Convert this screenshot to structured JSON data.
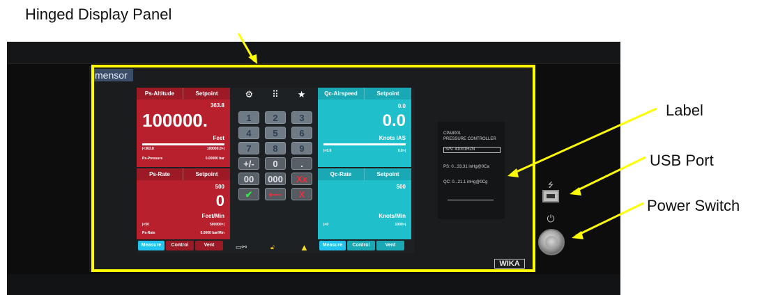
{
  "callouts": {
    "hinged_display_panel": "Hinged Display Panel",
    "label": "Label",
    "usb_port": "USB Port",
    "power_switch": "Power Switch"
  },
  "colors": {
    "callout_line": "#ffff00",
    "red_panel": "#b8202e",
    "cyan_panel": "#1fc0cc",
    "active_tab": "#21c3ef"
  },
  "device": {
    "brand": "mensor",
    "maker_badge": "WIKA"
  },
  "screen": {
    "left_top": {
      "header_a": "Ps-Altitude",
      "header_b": "Setpoint",
      "setpoint": "363.8",
      "reading": "100000.",
      "unit": "Feet",
      "range_min": "|<363.8",
      "range_max": "100000.0>|",
      "footer_label": "Ps-Pressure",
      "footer_value": "0.00000 bar",
      "bar_fill": 0.95
    },
    "left_bottom": {
      "header_a": "Ps-Rate",
      "header_b": "Setpoint",
      "setpoint": "500",
      "reading": "0",
      "unit": "Feet/Min",
      "range_min": "|<50",
      "range_max": "500000>|",
      "footer_label": "Ps-Rate",
      "footer_value": "0.0000 bar/Min"
    },
    "left_tabs": [
      "Measure",
      "Control",
      "Vent"
    ],
    "right_top": {
      "header_a": "Qc-Airspeed",
      "header_b": "Setpoint",
      "setpoint": "0.0",
      "reading": "0.0",
      "unit": "Knots IAS",
      "range_min": "|<0.0",
      "range_max": "0.0>|",
      "bar_fill": 0.95
    },
    "right_bottom": {
      "header_a": "Qc-Rate",
      "header_b": "Setpoint",
      "setpoint": "500",
      "unit": "Knots/Min",
      "range_min": "|<0",
      "range_max": "1000>|"
    },
    "right_tabs": [
      "Measure",
      "Control",
      "Vent"
    ],
    "keypad": {
      "top_icons": [
        "gears-icon",
        "keypad-icon",
        "star-icon"
      ],
      "keys": [
        "1",
        "2",
        "3",
        "4",
        "5",
        "6",
        "7",
        "8",
        "9",
        "+/-",
        "0",
        ".",
        "00",
        "000",
        "Xx"
      ],
      "ok": "✔",
      "back": "⟵",
      "cancel": "X"
    }
  },
  "label_card": {
    "model": "CPA8001",
    "title": "PRESSURE CONTROLLER",
    "serial": "S/N: 41001HZN",
    "ps_range": "PS: 0...33.31 inHg@0Ca",
    "qc_range": "QC: 0...21.1 inHg@0Cg"
  }
}
